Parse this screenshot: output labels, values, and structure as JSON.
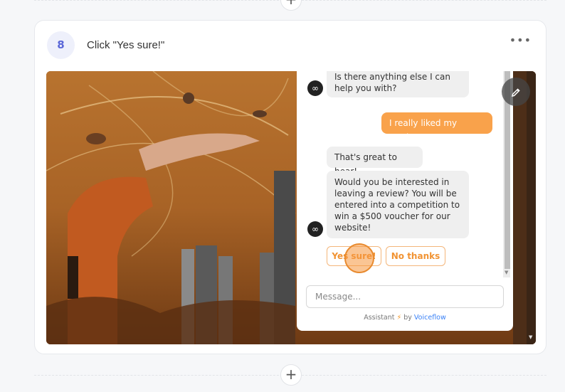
{
  "step": {
    "number": "8",
    "title": "Click \"Yes sure!\"",
    "menu_icon": "more-horizontal-icon"
  },
  "add_step_top": "+",
  "add_step_bottom": "+",
  "chat": {
    "messages": [
      {
        "from": "bot",
        "text": "Is there anything else I can help you with?"
      },
      {
        "from": "user",
        "text": "I really liked my product"
      },
      {
        "from": "bot",
        "text": "That's great to hear!"
      },
      {
        "from": "bot",
        "text": "Would you be interested in leaving a review? You will be entered into a competition to win a $500 voucher for our website!"
      }
    ],
    "msg1_line1": "Is there anything else I can",
    "msg1_line2": "help you with?",
    "msg2": "I really liked my product",
    "msg3": "That's great to hear!",
    "msg4_lines": [
      "Would you be interested in",
      "leaving a review? You will be",
      "entered into a competition to",
      "win a $500 voucher for our",
      "website!"
    ],
    "choices": [
      "Yes sure!",
      "No thanks"
    ],
    "input_placeholder": "Message...",
    "footer_prefix": "Assistant",
    "footer_by": "by",
    "footer_brand": "Voiceflow",
    "bot_avatar_icon": "infinity-icon",
    "edit_icon": "pencil-icon"
  },
  "colors": {
    "accent_orange": "#f9a24b",
    "step_badge": "#5a67d8",
    "brand_link": "#3b82f6"
  }
}
